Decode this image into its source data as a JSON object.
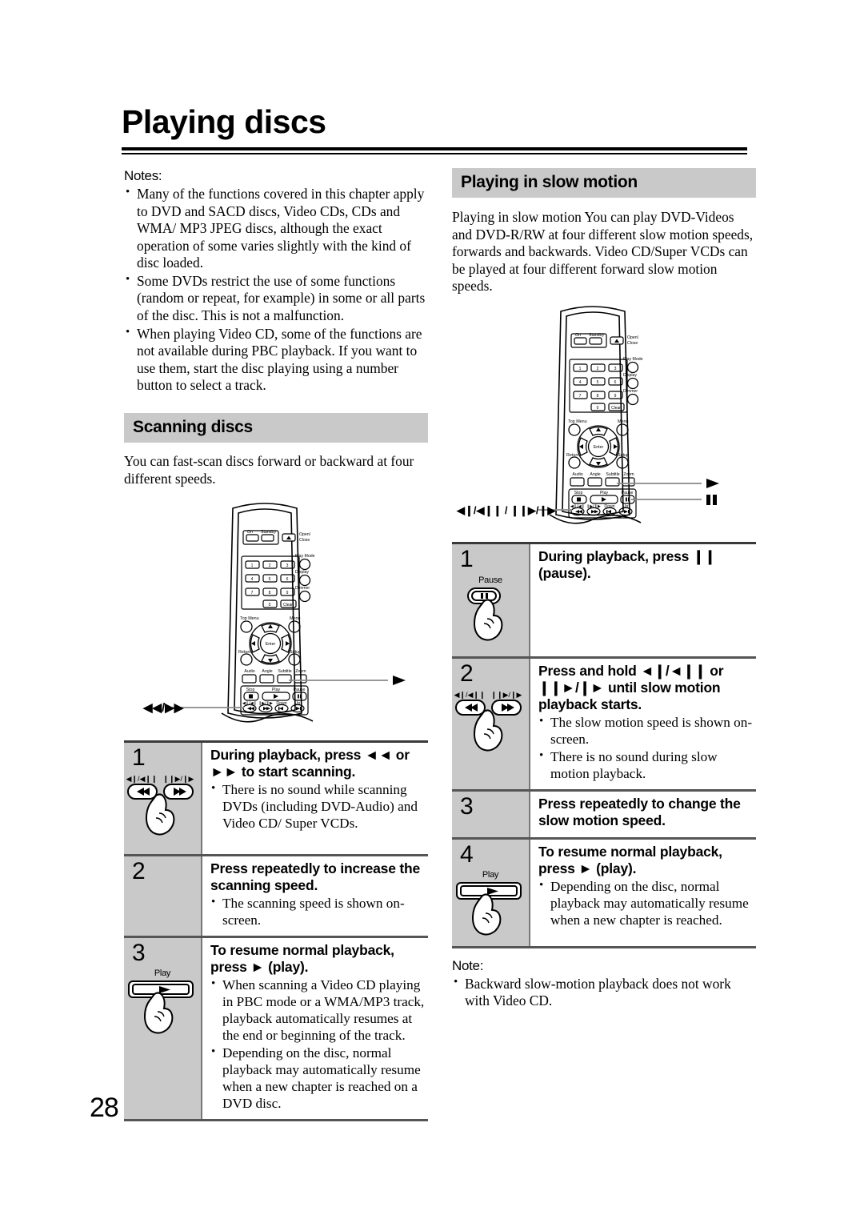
{
  "page": {
    "title": "Playing discs",
    "number": "28"
  },
  "left_column": {
    "notes_label": "Notes:",
    "notes": [
      "Many of the functions covered in this chapter apply to DVD and SACD discs, Video CDs, CDs and WMA/ MP3 JPEG discs, although the exact operation of some varies slightly with the kind of disc loaded.",
      "Some DVDs restrict the use of some functions (random or repeat, for example) in some or all parts of the disc. This is not a malfunction.",
      "When playing Video CD, some of the functions are not available during PBC playback. If you want to use them, start the disc playing using a number button to select a track."
    ],
    "section_heading": "Scanning discs",
    "intro": "You can fast-scan discs forward or backward at four different speeds.",
    "remote_callouts": {
      "left_label": "◄◄/►►",
      "right_label": "►"
    },
    "steps": [
      {
        "number": "1",
        "heading": "During playback, press ◄◄ or ►► to start scanning.",
        "button_labels": [
          "◄❙/◄❙❙",
          "❙❙►/❙►"
        ],
        "bullets": [
          "There is no sound while scanning DVDs (including DVD-Audio) and Video CD/ Super VCDs."
        ]
      },
      {
        "number": "2",
        "heading": "Press repeatedly to increase the scanning speed.",
        "button_labels": [],
        "bullets": [
          "The scanning speed is shown on-screen."
        ]
      },
      {
        "number": "3",
        "heading": "To resume normal playback, press ► (play).",
        "button_labels": [
          "Play"
        ],
        "bullets": [
          "When scanning a Video CD playing in PBC mode or a WMA/MP3 track, playback automatically resumes at the end or beginning of the track.",
          "Depending on the disc, normal playback may automatically resume when a new chapter is reached on a DVD disc."
        ]
      }
    ]
  },
  "right_column": {
    "section_heading": "Playing in slow motion",
    "intro": "Playing in slow motion You can play DVD-Videos and DVD-R/RW at four different slow motion speeds, forwards and backwards. Video CD/Super VCDs can be played at four different forward slow motion speeds.",
    "remote_callouts": {
      "left_label": "◄❙/◄❙❙ / ❙❙►/❙►",
      "right_label_play": "►",
      "right_label_pause": "❙❙"
    },
    "steps": [
      {
        "number": "1",
        "heading": "During playback, press ❙❙ (pause).",
        "button_labels": [
          "Pause"
        ],
        "bullets": []
      },
      {
        "number": "2",
        "heading": "Press and hold ◄❙/◄❙❙ or ❙❙►/❙► until slow motion playback starts.",
        "button_labels": [
          "◄❙/◄❙❙",
          "❙❙►/❙►"
        ],
        "bullets": [
          "The slow motion speed is shown on-screen.",
          "There is no sound during slow motion playback."
        ]
      },
      {
        "number": "3",
        "heading": "Press repeatedly to change the slow motion speed.",
        "button_labels": [],
        "bullets": []
      },
      {
        "number": "4",
        "heading": "To resume normal playback, press ► (play).",
        "button_labels": [
          "Play"
        ],
        "bullets": [
          "Depending on the disc, normal playback may automatically resume when a new chapter is reached."
        ]
      }
    ],
    "note_label": "Note:",
    "notes": [
      "Backward slow-motion playback does not work with Video CD."
    ]
  },
  "remote_diagram": {
    "power_group": [
      "On",
      "Standby"
    ],
    "open_close": "Open/ Close",
    "numeric_keys": [
      "1",
      "2",
      "3",
      "4",
      "5",
      "6",
      "7",
      "8",
      "9",
      "0"
    ],
    "clear_key": "Clear",
    "side_keys": [
      "Play Mode",
      "Display",
      "Dimmer"
    ],
    "menu_keys": [
      "Top Menu",
      "Menu",
      "Return",
      "Setup"
    ],
    "enter_key": "Enter",
    "function_keys": [
      "Audio",
      "Angle",
      "Subtitle",
      "Zoom"
    ],
    "transport_keys": [
      "Stop",
      "Play",
      "Pause"
    ],
    "skip_keys": [
      "◄❙/◄❙❙",
      "❙❙►/❙►",
      "Down",
      "Up"
    ]
  },
  "colors": {
    "section_header_bg": "#c9c9c9",
    "step_cell_bg": "#c9c9c9",
    "rule": "#000000",
    "callout_line": "#8a8a8a"
  }
}
